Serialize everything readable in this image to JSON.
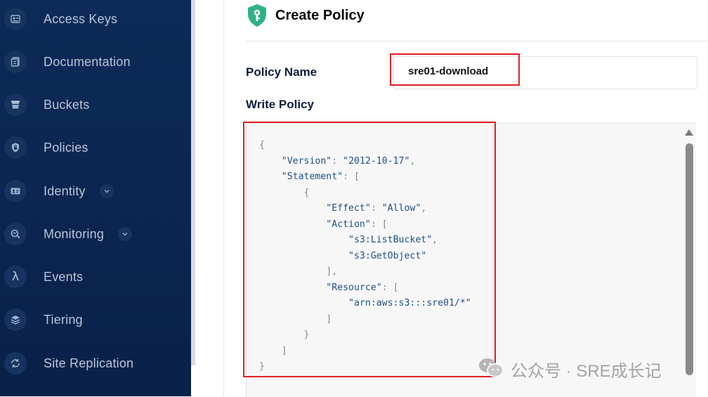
{
  "sidebar": {
    "items": [
      {
        "label": "Access Keys",
        "icon": "access-keys-icon"
      },
      {
        "label": "Documentation",
        "icon": "documentation-icon"
      },
      {
        "label": "Buckets",
        "icon": "buckets-icon"
      },
      {
        "label": "Policies",
        "icon": "policies-icon"
      },
      {
        "label": "Identity",
        "icon": "identity-icon",
        "expandable": true
      },
      {
        "label": "Monitoring",
        "icon": "monitoring-icon",
        "expandable": true
      },
      {
        "label": "Events",
        "icon": "lambda-icon"
      },
      {
        "label": "Tiering",
        "icon": "tiering-icon"
      },
      {
        "label": "Site Replication",
        "icon": "site-replication-icon"
      }
    ]
  },
  "header": {
    "title": "Create Policy",
    "icon": "shield-key-icon"
  },
  "form": {
    "policy_name_label": "Policy Name",
    "policy_name_value": "sre01-download",
    "write_policy_label": "Write Policy",
    "policy_json": "{\n    \"Version\": \"2012-10-17\",\n    \"Statement\": [\n        {\n            \"Effect\": \"Allow\",\n            \"Action\": [\n                \"s3:ListBucket\",\n                \"s3:GetObject\"\n            ],\n            \"Resource\": [\n                \"arn:aws:s3:::sre01/*\"\n            ]\n        }\n    ]\n}"
  },
  "watermark": {
    "text": "公众号 · SRE成长记",
    "icon": "wechat-icon"
  },
  "colors": {
    "sidebar_bg": "#0b2550",
    "accent_green": "#2fb385",
    "highlight_red": "#e02020"
  }
}
